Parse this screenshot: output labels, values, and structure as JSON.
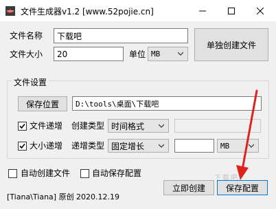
{
  "window": {
    "title": "文件生成器v1.2 [www.52pojie.cn]",
    "minimize": "—",
    "maximize": "☐",
    "close": "✕"
  },
  "file_name": {
    "label": "文件名称",
    "value": "下载吧"
  },
  "file_size": {
    "label": "文件大小",
    "value": "20",
    "unit_label": "单位",
    "unit": "MB"
  },
  "single_create_button": "单独创建文件",
  "settings": {
    "title": "文件设置",
    "save_location_button": "保存位置",
    "save_path": "D:\\tools\\桌面\\下载吧",
    "file_increment": {
      "label": "文件递增",
      "checked": true,
      "type_label": "创建类型",
      "type_value": "时间格式",
      "extra_value": ""
    },
    "size_increment": {
      "label": "大小递增",
      "checked": true,
      "type_label": "递增类型",
      "type_value": "固定增长",
      "amount_value": "",
      "unit": "MB"
    }
  },
  "auto_create": {
    "label": "自动创建文件",
    "checked": false
  },
  "auto_save_config": {
    "label": "自动保存配置",
    "checked": false
  },
  "footer_credit": "[Tiana\\Tiana] 原创 2020.12.19",
  "create_now_button": "立即创建",
  "save_config_button": "保存配置",
  "watermark": "下载吧",
  "colors": {
    "annotation_arrow": "#e0201b"
  }
}
